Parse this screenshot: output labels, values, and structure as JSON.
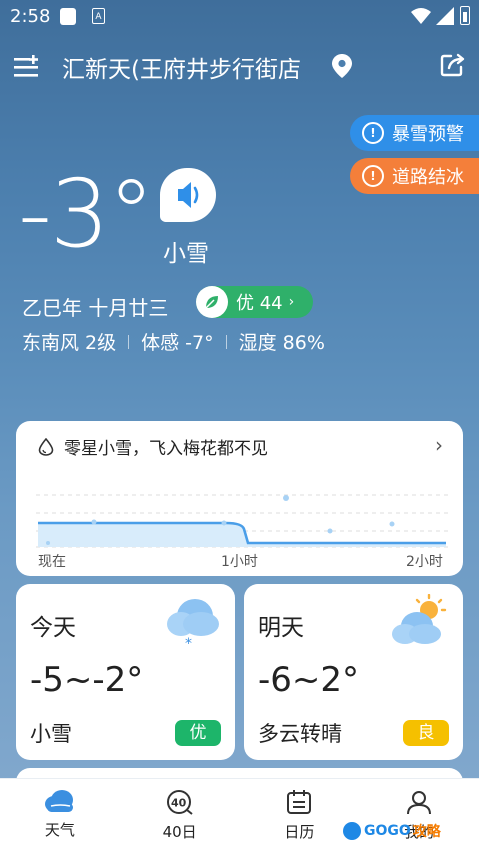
{
  "status": {
    "time": "2:58",
    "doc_icon_letter": "A"
  },
  "header": {
    "location": "汇新天(王府井步行街店",
    "icons": [
      "add-city-menu-icon",
      "location-pin-icon",
      "share-icon"
    ]
  },
  "alerts": [
    {
      "label": "暴雪预警",
      "color": "#2f8fe8"
    },
    {
      "label": "道路结冰",
      "color": "#f47f3a"
    }
  ],
  "current": {
    "temperature": "-3°",
    "condition": "小雪",
    "lunar_date": "乙巳年 十月廿三",
    "aqi": "优 44",
    "aqi_color": "#2fb06a",
    "wind": "东南风 2级",
    "feels_like": "体感 -7°",
    "humidity": "湿度 86%"
  },
  "precipitation": {
    "summary": "零星小雪，飞入梅花都不见",
    "ticks": [
      "现在",
      "1小时",
      "2小时"
    ]
  },
  "forecast": [
    {
      "day": "今天",
      "range": "-5~-2°",
      "condition": "小雪",
      "aqi": "优",
      "aqi_color": "#1db56a",
      "icon": "cloud-snow-icon"
    },
    {
      "day": "明天",
      "range": "-6~2°",
      "condition": "多云转晴",
      "aqi": "良",
      "aqi_color": "#f5c000",
      "icon": "sun-cloud-icon"
    }
  ],
  "nav": [
    {
      "label": "天气",
      "icon": "weather-cloud-icon"
    },
    {
      "label": "40日",
      "icon": "forty-day-icon"
    },
    {
      "label": "日历",
      "icon": "calendar-icon"
    },
    {
      "label": "我的",
      "icon": "profile-icon"
    }
  ],
  "watermark": {
    "text": "GOGO",
    "suffix": "攻略"
  }
}
